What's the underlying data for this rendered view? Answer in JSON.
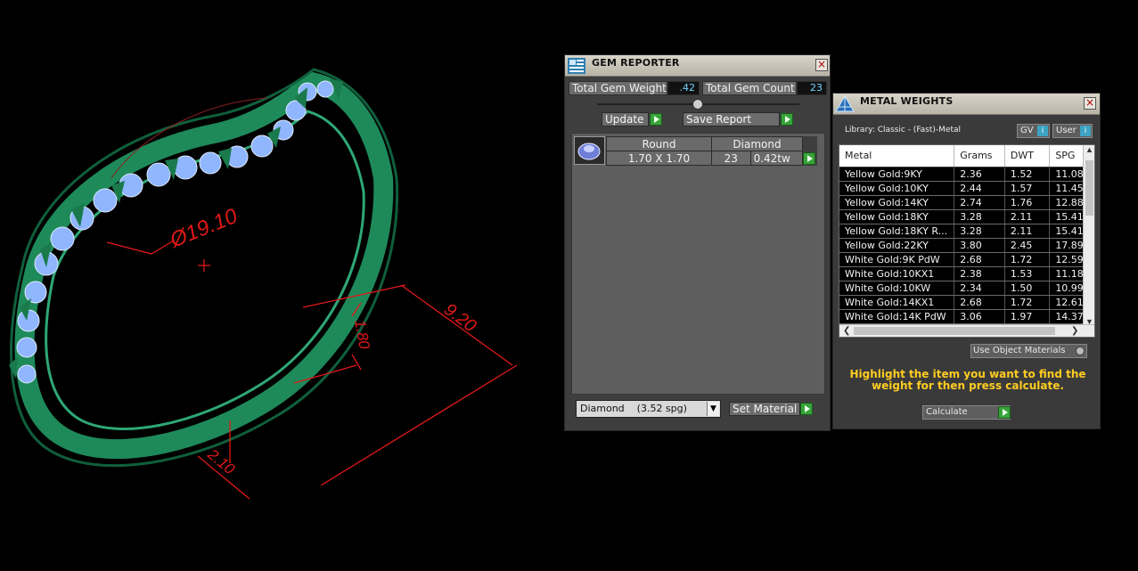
{
  "viewport": {
    "dimensions": {
      "diameter": "Ø19.10",
      "width": "9.20",
      "thickness": "1.80",
      "height": "2.10"
    }
  },
  "gem_reporter": {
    "title": "GEM REPORTER",
    "close": "×",
    "total_gem_weight_label": "Total Gem Weight",
    "total_gem_weight_value": ".42",
    "total_gem_count_label": "Total Gem Count",
    "total_gem_count_value": "23",
    "update_label": "Update",
    "save_report_label": "Save Report",
    "gem_row": {
      "shape": "Round",
      "material": "Diamond",
      "size": "1.70 X 1.70",
      "count": "23",
      "weight": "0.42tw"
    },
    "material_select": "Diamond    (3.52 spg)",
    "set_material_label": "Set Material"
  },
  "metal_weights": {
    "title": "METAL WEIGHTS",
    "close": "×",
    "library": "Library: Classic - (Fast)-Metal",
    "gv_label": "GV",
    "user_label": "User",
    "columns": [
      "Metal",
      "Grams",
      "DWT",
      "SPG"
    ],
    "rows": [
      [
        "Yellow Gold:9KY",
        "2.36",
        "1.52",
        "11.08"
      ],
      [
        "Yellow Gold:10KY",
        "2.44",
        "1.57",
        "11.45"
      ],
      [
        "Yellow Gold:14KY",
        "2.74",
        "1.76",
        "12.88"
      ],
      [
        "Yellow Gold:18KY",
        "3.28",
        "2.11",
        "15.41"
      ],
      [
        "Yellow Gold:18KY R...",
        "3.28",
        "2.11",
        "15.41"
      ],
      [
        "Yellow Gold:22KY",
        "3.80",
        "2.45",
        "17.89"
      ],
      [
        "White Gold:9K PdW",
        "2.68",
        "1.72",
        "12.59"
      ],
      [
        "White Gold:10KX1",
        "2.38",
        "1.53",
        "11.18"
      ],
      [
        "White Gold:10KW",
        "2.34",
        "1.50",
        "10.99"
      ],
      [
        "White Gold:14KX1",
        "2.68",
        "1.72",
        "12.61"
      ],
      [
        "White Gold:14K PdW",
        "3.06",
        "1.97",
        "14.37"
      ]
    ],
    "use_object_materials": "Use Object Materials",
    "hint": "Highlight the item you want to find the weight for then press calculate.",
    "calculate_label": "Calculate"
  },
  "colors": {
    "ring_green": "#1e8a5a",
    "gem_blue": "#8fb6ff",
    "dimension_red": "#e01818",
    "go_green": "#37a33a",
    "hint_yellow": "#ffcc22"
  }
}
